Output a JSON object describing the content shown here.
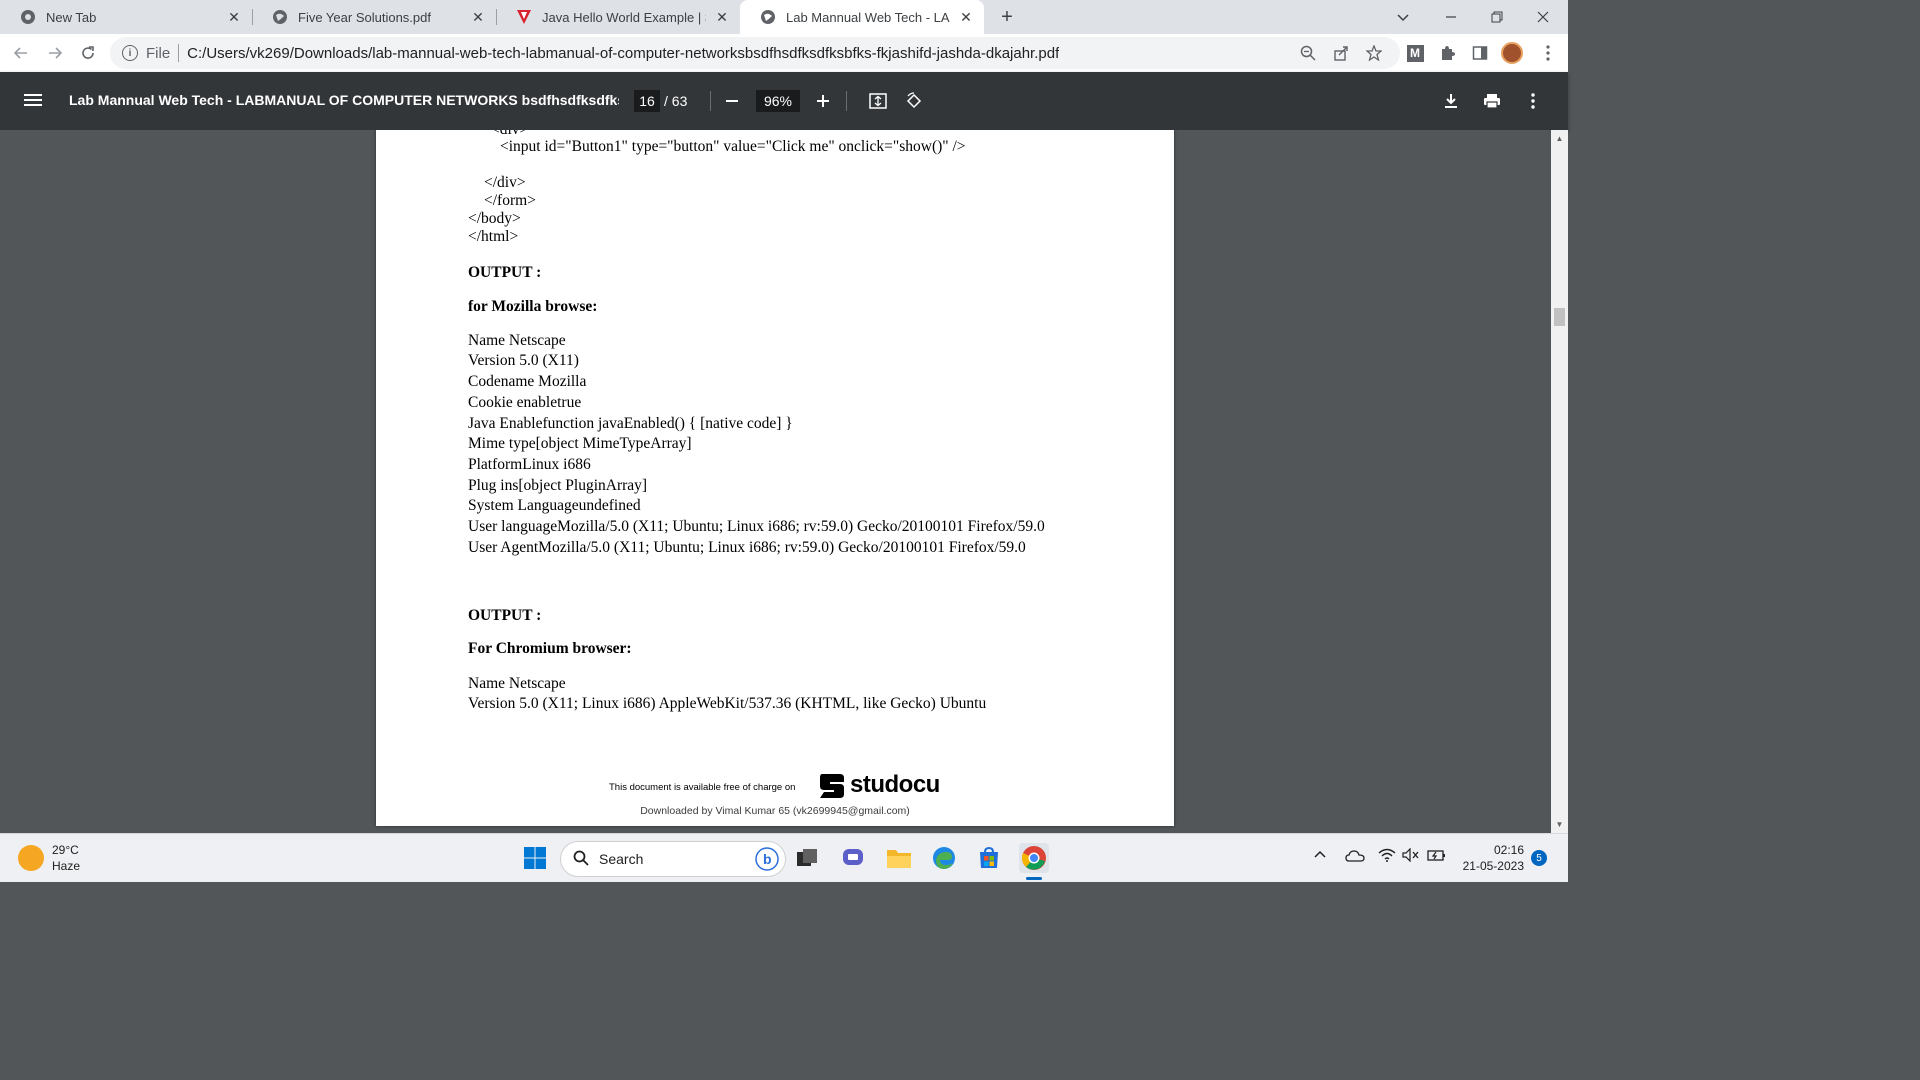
{
  "browser": {
    "tabs": [
      {
        "title": "New Tab",
        "icon": "chrome-icon"
      },
      {
        "title": "Five Year Solutions.pdf",
        "icon": "globe-icon"
      },
      {
        "title": "Java Hello World Example | Simpl",
        "icon": "brand-v-icon"
      },
      {
        "title": "Lab Mannual Web Tech - LABMA",
        "icon": "globe-icon",
        "active": true
      }
    ],
    "address": {
      "scheme": "File",
      "url": "C:/Users/vk269/Downloads/lab-mannual-web-tech-labmanual-of-computer-networksbsdfhsdfksdfksbfks-fkjashifd-jashda-dkajahr.pdf"
    },
    "profile_letter": "M"
  },
  "pdf_toolbar": {
    "title": "Lab Mannual Web Tech - LABMANUAL OF COMPUTER NETWORKS bsdfhsdfksdfksb...",
    "current_page": "16",
    "total_pages": "/ 63",
    "zoom": "96%"
  },
  "page": {
    "code_lines": [
      "<input id=\"Button1\" type=\"button\" value=\"Click me\" onclick=\"show()\" />",
      "</div>",
      "</form>",
      "</body>",
      "</html>"
    ],
    "output1_heading": "OUTPUT :",
    "output1_subheading": "for Mozilla browse:",
    "output1_lines": [
      "Name Netscape",
      "Version 5.0 (X11)",
      "Codename Mozilla",
      "Cookie enabletrue",
      "Java Enablefunction javaEnabled() { [native code] }",
      "Mime type[object MimeTypeArray]",
      "PlatformLinux i686",
      "Plug ins[object PluginArray]",
      "System Languageundefined",
      "User languageMozilla/5.0 (X11; Ubuntu; Linux i686; rv:59.0) Gecko/20100101 Firefox/59.0",
      "User AgentMozilla/5.0 (X11; Ubuntu; Linux i686; rv:59.0) Gecko/20100101 Firefox/59.0"
    ],
    "output2_heading": "OUTPUT :",
    "output2_subheading": "For Chromium browser:",
    "output2_lines": [
      "Name Netscape",
      "Version 5.0 (X11; Linux i686) AppleWebKit/537.36 (KHTML, like Gecko) Ubuntu"
    ],
    "footer_note": "This document is available free of charge on",
    "footer_brand": "studocu",
    "downloaded_by": "Downloaded by Vimal Kumar 65 (vk2699945@gmail.com)"
  },
  "taskbar": {
    "weather_temp": "29°C",
    "weather_desc": "Haze",
    "search_label": "Search",
    "time": "02:16",
    "date": "21-05-2023",
    "notification_count": "5"
  }
}
